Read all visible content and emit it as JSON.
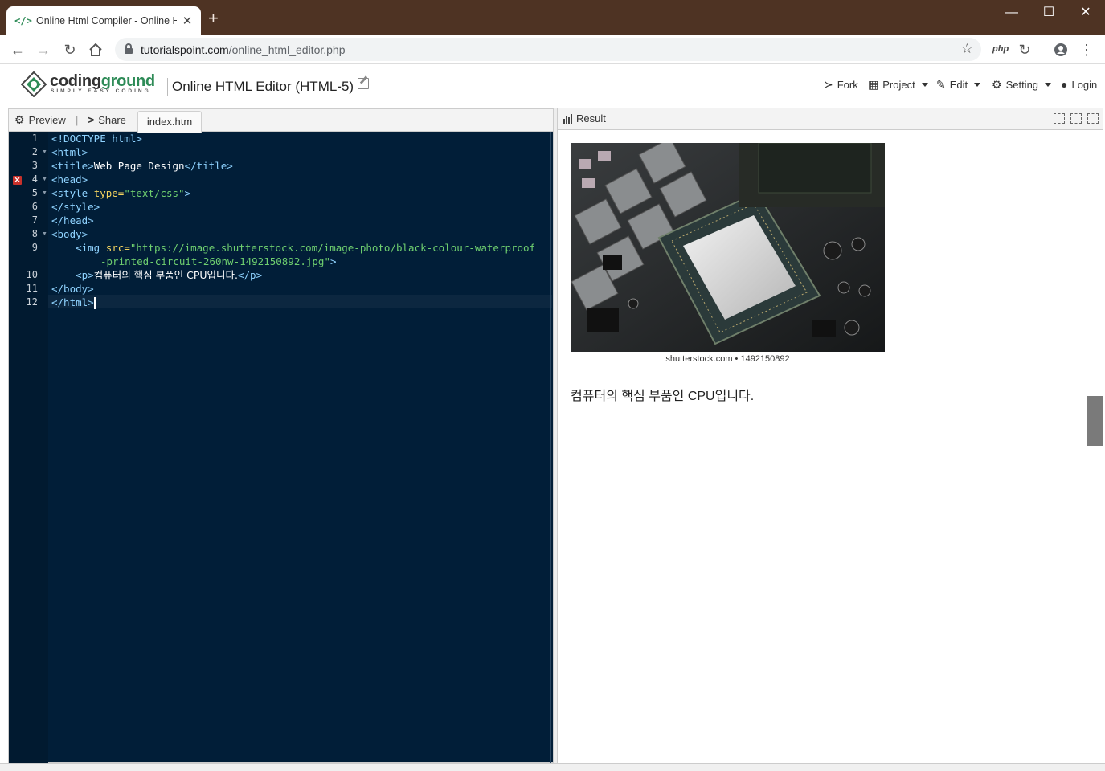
{
  "browser": {
    "tab_title": "Online Html Compiler - Online H",
    "tab_favicon": "</>",
    "new_tab": "+",
    "url_host": "tutorialspoint.com",
    "url_path": "/online_html_editor.php",
    "ext_php": "php",
    "window": {
      "minimize": "—",
      "maximize": "☐",
      "close": "✕"
    }
  },
  "site": {
    "logo_primary": "coding",
    "logo_secondary": "ground",
    "logo_tagline": "SIMPLY EASY CODING",
    "page_title": "Online HTML Editor (HTML-5)",
    "menu": {
      "fork": "Fork",
      "project": "Project",
      "edit": "Edit",
      "setting": "Setting",
      "login": "Login"
    }
  },
  "editor": {
    "preview_label": "Preview",
    "share_label": "Share",
    "file_tab": "index.htm",
    "line_numbers": [
      "1",
      "2",
      "3",
      "4",
      "5",
      "6",
      "7",
      "8",
      "9",
      "",
      "10",
      "11",
      "12"
    ],
    "code": {
      "l1": "<!DOCTYPE html>",
      "l2": "<html>",
      "l3_open": "<title>",
      "l3_text": "Web Page Design",
      "l3_close": "</title>",
      "l4": "<head>",
      "l5_open": "<style ",
      "l5_attr": "type=",
      "l5_val": "\"text/css\"",
      "l5_close": ">",
      "l6": "</style>",
      "l7": "</head>",
      "l8": "<body>",
      "l9_indent": "    ",
      "l9_open": "<img ",
      "l9_attr": "src=",
      "l9_val_a": "\"https://image.shutterstock.com/image-photo/black-colour-waterproof",
      "l9_val_b": "-printed-circuit-260nw-1492150892.jpg\"",
      "l9_close": ">",
      "l10_open": "<p>",
      "l10_text": "컴퓨터의 핵심 부품인 CPU입니다.",
      "l10_close": "</p>",
      "l11": "</body>",
      "l12": "</html>"
    },
    "error_marker": "✕"
  },
  "result": {
    "label": "Result",
    "image_caption": "shutterstock.com • 1492150892",
    "paragraph": "컴퓨터의 핵심 부품인 CPU입니다."
  },
  "colors": {
    "titlebar": "#4e3323",
    "editor_bg": "#011e38",
    "tag": "#8fd3ff",
    "attr": "#f4d35e",
    "string": "#6fcf6f"
  }
}
